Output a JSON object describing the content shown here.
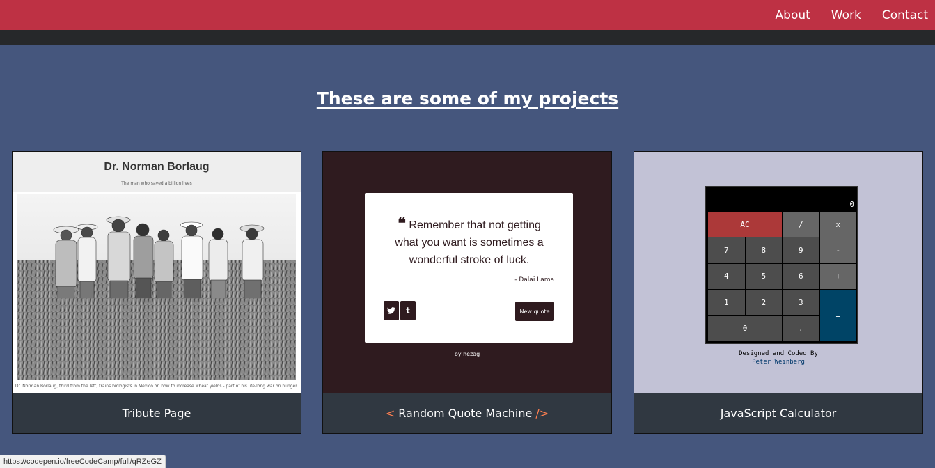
{
  "nav": {
    "links": [
      "About",
      "Work",
      "Contact"
    ]
  },
  "section": {
    "title": "These are some of my projects"
  },
  "projects": [
    {
      "title": "Tribute Page",
      "preview": {
        "heading": "Dr. Norman Borlaug",
        "subheading": "The man who saved a billion lives",
        "caption": "Dr. Norman Borlaug, third from the left, trains biologists in Mexico on how to increase wheat yields - part of his life-long war on hunger."
      }
    },
    {
      "title": "Random Quote Machine",
      "bracket_open": "<",
      "bracket_close": "/>",
      "preview": {
        "quote_mark": "❝",
        "quote": "Remember that not getting what you want is sometimes a wonderful stroke of luck.",
        "author": "- Dalai Lama",
        "twitter": "t",
        "tumblr": "t",
        "new_quote_label": "New quote",
        "by_line": "by hezag"
      }
    },
    {
      "title": "JavaScript Calculator",
      "preview": {
        "display": "0",
        "keys": {
          "clear": "AC",
          "divide": "/",
          "multiply": "x",
          "seven": "7",
          "eight": "8",
          "nine": "9",
          "minus": "-",
          "four": "4",
          "five": "5",
          "six": "6",
          "plus": "+",
          "one": "1",
          "two": "2",
          "three": "3",
          "equals": "=",
          "zero": "0",
          "decimal": "."
        },
        "credit_line": "Designed and Coded By",
        "credit_author": "Peter Weinberg"
      }
    }
  ],
  "status_bar": {
    "url": "https://codepen.io/freeCodeCamp/full/qRZeGZ"
  }
}
